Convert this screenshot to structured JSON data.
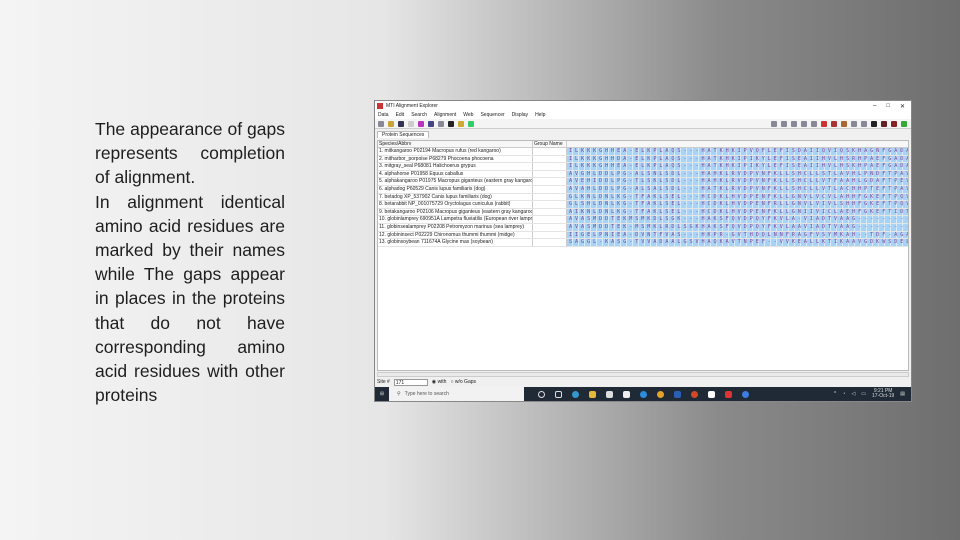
{
  "slide": {
    "paragraphs": [
      "The appearance of gaps represents completion of alignment.",
      "In alignment identical amino acid residues are marked by their names while The gaps appear in places in the proteins that do not have corresponding amino acid residues with other proteins"
    ]
  },
  "window": {
    "title": "MTI Alignment Explorer",
    "controls": [
      "–",
      "□",
      "✕"
    ]
  },
  "menu": [
    "Data",
    "Edit",
    "Search",
    "Alignment",
    "Web",
    "Sequencer",
    "Display",
    "Help"
  ],
  "tab": "Protein Sequences",
  "columns": {
    "species": "Species/Abbrv",
    "group": "Group Name"
  },
  "rows": [
    {
      "name": "1. mitkangaroo P02194 Macropus rufus (red kangaroo)",
      "seq": "ILKKKGHHEA-ELKPLAQS---HATKHKIPVQFLEFISDAIIQVIQSKHAGNFGADAQGAMKKALEL"
    },
    {
      "name": "2. mitharbor_porpoise P68279 Phocoena phocoena",
      "seq": "ILKKKGHHDA-ELKPLAQS---HATKHKIPIKYLEFISEAIIHVLHSRHPAEFGADAQGAMNKALEL"
    },
    {
      "name": "3. mitgray_seal P68081 Halichoerus grypus",
      "seq": "ILKKKGHHEA-ELKPLAQS---HATKHKIPIKYLEFISEAIIHVLHSKHPAEFGADAQAAMKKALEL"
    },
    {
      "name": "4. alphahorse P01958 Equus caballus",
      "seq": "AVGHLDDLPG-ALSNLSDL---HAHKLRVDPVNFKLLSHCLLSTLAVHLPNDFTPAVHASLDKFLSS"
    },
    {
      "name": "5. alphakangaroo P01975 Macropus giganteus (eastern gray kangaroo)",
      "seq": "AVEHIDDLPG-TLSKLSDL---HAHKLRVDPVNFKLLSHCLLVTFAAHLGDAFTPEVHASLDKFLAA"
    },
    {
      "name": "6. alphadog P60529 Canis lupus familiaris (dog)",
      "seq": "AVAHLDDLPG-ALSALSDL---HATKLRVDPVNFKLLSHCLLVTLACHHPTEFTPAVHASLDKFFAA"
    },
    {
      "name": "7. betadog XP_537902 Canis lupus familiaris (dog)",
      "seq": "GLKNLDNLKG-TFAKLSEL---HCDKLHVDPENFKLLGNVLVCVLAHHFGKEFTPQVQAAYQKVVAG"
    },
    {
      "name": "8. betarabbit NP_001075729 Oryctolagus cuniculus (rabbit)",
      "seq": "GLSHLDNLKG-TFAKLSEL---HCDKLHVDPENFRLLGNVLVIVLSHHFGKEFTPQVQAAYQKVVAG"
    },
    {
      "name": "9. betakangaroo P02106 Macropus giganteus (eastern gray kangaroo)",
      "seq": "AIKNLDNLKG-TFAKLSEL---HCDKLHVDPENFKLLGNIIVICLAEHFGKEFTIDTQVAWQKLVAG"
    },
    {
      "name": "10. globinlamprey 690951A Lampetra fluviatilis (European river lamprey)",
      "seq": "AVASMDDTEKMSMKDLSGK---HAKSFQVDPQYFKVLA-VIADTVAAG----------DAGFEKLMSMC"
    },
    {
      "name": "11. globinsealamprey P02208 Petromyzon marinus (sea lamprey)",
      "seq": "AVASMDDTEK-MSMKLRDLSGKHAKSFQVDPQYFKVLAAVIADTVAAG---------DAGFEKLMSM"
    },
    {
      "name": "12. globininsect P02229 Chironomus thummi thummi (midge)",
      "seq": "IIGELPNIEA-DVNTFVAS---HKPR-GVTHDQLNNFRAGFVSYMKAH--TDF-AGAEAAWGATLDT"
    },
    {
      "name": "13. globinsoybean 711674A Glycine max (soybean)",
      "seq": "SAGGL-KASG-TVVADAALGSVHAQKAVTNPEF--VVKEALLKTIKAAVGDKWSDELSRAWEVAYDE"
    }
  ],
  "status": {
    "site_label": "Site #",
    "site_value": "171",
    "with_label": "with",
    "without_label": "w/o Gaps"
  },
  "taskbar": {
    "search_placeholder": "Type here to search",
    "time": "9:21 PM",
    "date": "17-Oct-19"
  },
  "colors": {
    "residue_bg": "#a9d3f5",
    "residue_text": "#7a4a9a",
    "taskbar": "#1f2a36"
  }
}
